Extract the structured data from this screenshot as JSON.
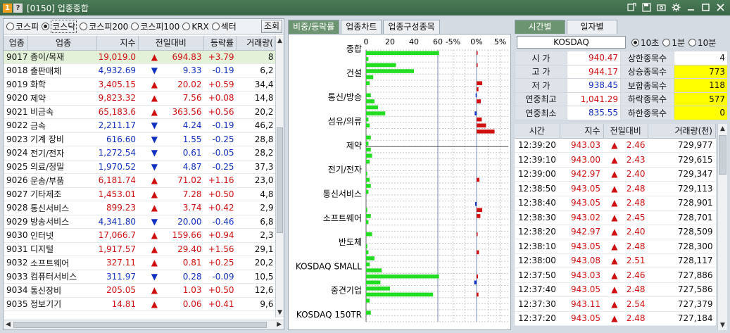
{
  "window": {
    "title": "[0150] 업종종합"
  },
  "market_radios": [
    {
      "label": "코스피",
      "selected": false
    },
    {
      "label": "코스닥",
      "selected": true
    },
    {
      "label": "코스피200",
      "selected": false
    },
    {
      "label": "코스피100",
      "selected": false
    },
    {
      "label": "KRX",
      "selected": false
    },
    {
      "label": "섹터",
      "selected": false
    }
  ],
  "query_button": "조회",
  "sector_table": {
    "headers": [
      "업종",
      "업종",
      "지수",
      "전일대비",
      "등락률",
      "거래량("
    ],
    "rows": [
      {
        "code": "9017",
        "name": "종이/목재",
        "index": "19,019.0",
        "dir": "up",
        "change": "694.83",
        "rate": "+3.79",
        "volume": "8"
      },
      {
        "code": "9018",
        "name": "출판매체",
        "index": "4,932.69",
        "dir": "down",
        "change": "9.33",
        "rate": "-0.19",
        "volume": "6,2"
      },
      {
        "code": "9019",
        "name": "화학",
        "index": "3,405.15",
        "dir": "up",
        "change": "20.02",
        "rate": "+0.59",
        "volume": "34,4"
      },
      {
        "code": "9020",
        "name": "제약",
        "index": "9,823.32",
        "dir": "up",
        "change": "7.56",
        "rate": "+0.08",
        "volume": "14,8"
      },
      {
        "code": "9021",
        "name": "비금속",
        "index": "65,183.6",
        "dir": "up",
        "change": "363.56",
        "rate": "+0.56",
        "volume": "20,2"
      },
      {
        "code": "9022",
        "name": "금속",
        "index": "2,211.17",
        "dir": "down",
        "change": "4.24",
        "rate": "-0.19",
        "volume": "46,2"
      },
      {
        "code": "9023",
        "name": "기계 장비",
        "index": "616.60",
        "dir": "down",
        "change": "1.55",
        "rate": "-0.25",
        "volume": "28,8"
      },
      {
        "code": "9024",
        "name": "전기/전자",
        "index": "1,272.54",
        "dir": "down",
        "change": "0.61",
        "rate": "-0.05",
        "volume": "28,2"
      },
      {
        "code": "9025",
        "name": "의료/정밀",
        "index": "1,970.52",
        "dir": "down",
        "change": "4.87",
        "rate": "-0.25",
        "volume": "37,3"
      },
      {
        "code": "9026",
        "name": "운송/부품",
        "index": "6,181.74",
        "dir": "up",
        "change": "71.02",
        "rate": "+1.16",
        "volume": "23,0"
      },
      {
        "code": "9027",
        "name": "기타제조",
        "index": "1,453.01",
        "dir": "up",
        "change": "7.28",
        "rate": "+0.50",
        "volume": "4,8"
      },
      {
        "code": "9028",
        "name": "통신서비스",
        "index": "899.23",
        "dir": "up",
        "change": "3.74",
        "rate": "+0.42",
        "volume": "2,9"
      },
      {
        "code": "9029",
        "name": "방송서비스",
        "index": "4,341.80",
        "dir": "down",
        "change": "20.00",
        "rate": "-0.46",
        "volume": "6,8"
      },
      {
        "code": "9030",
        "name": "인터넷",
        "index": "17,066.7",
        "dir": "up",
        "change": "159.66",
        "rate": "+0.94",
        "volume": "2,3"
      },
      {
        "code": "9031",
        "name": "디지털",
        "index": "1,917.57",
        "dir": "up",
        "change": "29.40",
        "rate": "+1.56",
        "volume": "29,1"
      },
      {
        "code": "9032",
        "name": "소프트웨어",
        "index": "327.11",
        "dir": "up",
        "change": "0.81",
        "rate": "+0.25",
        "volume": "20,2"
      },
      {
        "code": "9033",
        "name": "컴퓨터서비스",
        "index": "311.97",
        "dir": "down",
        "change": "0.28",
        "rate": "-0.09",
        "volume": "10,5"
      },
      {
        "code": "9034",
        "name": "통신장비",
        "index": "205.05",
        "dir": "up",
        "change": "1.03",
        "rate": "+0.50",
        "volume": "12,6"
      },
      {
        "code": "9035",
        "name": "정보기기",
        "index": "14.81",
        "dir": "up",
        "change": "0.06",
        "rate": "+0.41",
        "volume": "9,6"
      }
    ]
  },
  "mid_tabs": [
    "비중/등락률",
    "업종차트",
    "업종구성종목"
  ],
  "chart_data": {
    "type": "bar",
    "categories": [
      "종합",
      "건설",
      "통신/방송",
      "섬유/의류",
      "제약",
      "전기/전자",
      "통신서비스",
      "소프트웨어",
      "반도체",
      "KOSDAQ SMALL",
      "중견기업",
      "KOSDAQ 150TR"
    ],
    "weight_axis": [
      0,
      20,
      40,
      60
    ],
    "rate_axis": [
      "-5%",
      "0%",
      "5%"
    ],
    "weight_values": [
      61,
      2,
      25,
      40,
      6,
      3,
      0,
      4,
      7,
      10,
      16,
      2,
      3,
      0,
      4,
      2,
      4,
      5,
      3,
      0,
      1,
      3,
      4,
      2,
      0,
      0,
      1,
      4,
      2,
      0,
      5,
      0,
      1,
      2,
      7,
      3,
      13,
      61,
      12,
      20,
      56,
      3,
      0,
      4,
      0
    ],
    "rate_values": [
      0.1,
      0,
      0.2,
      0,
      0,
      1.2,
      0.4,
      -0.2,
      0.9,
      0,
      -0.4,
      1.1,
      2.0,
      3.8,
      0,
      0,
      0,
      0,
      0,
      0,
      0,
      0.6,
      0,
      0,
      0,
      -0.3,
      1.2,
      0.8,
      0,
      0,
      0.2,
      0,
      0,
      0.5,
      0,
      0,
      0,
      0.3,
      -0.5,
      0,
      0.4,
      0,
      0,
      0,
      0
    ]
  },
  "right_tabs": [
    "시간별",
    "일자별"
  ],
  "market_name": "KOSDAQ",
  "interval_radios": [
    {
      "label": "10초",
      "selected": true
    },
    {
      "label": "1분",
      "selected": false
    },
    {
      "label": "10분",
      "selected": false
    }
  ],
  "stats": [
    {
      "label": "시    가",
      "value": "940.47",
      "dir": "up",
      "label2": "상한종목수",
      "value2": "4",
      "hl": false
    },
    {
      "label": "고    가",
      "value": "944.17",
      "dir": "up",
      "label2": "상승종목수",
      "value2": "773",
      "hl": true
    },
    {
      "label": "저    가",
      "value": "938.45",
      "dir": "down",
      "label2": "보합종목수",
      "value2": "118",
      "hl": true
    },
    {
      "label": "연중최고",
      "value": "1,041.29",
      "dir": "up",
      "label2": "하락종목수",
      "value2": "577",
      "hl": true
    },
    {
      "label": "연중최소",
      "value": "835.55",
      "dir": "down",
      "label2": "하한종목수",
      "value2": "0",
      "hl": true
    }
  ],
  "tick_table": {
    "headers": [
      "시간",
      "지수",
      "전일대비",
      "거래량(천)"
    ],
    "rows": [
      {
        "time": "12:39:20",
        "index": "943.03",
        "change": "2.46",
        "volume": "729,977"
      },
      {
        "time": "12:39:10",
        "index": "943.00",
        "change": "2.43",
        "volume": "729,615"
      },
      {
        "time": "12:39:00",
        "index": "942.97",
        "change": "2.40",
        "volume": "729,347"
      },
      {
        "time": "12:38:50",
        "index": "943.05",
        "change": "2.48",
        "volume": "729,113"
      },
      {
        "time": "12:38:40",
        "index": "943.05",
        "change": "2.48",
        "volume": "728,901"
      },
      {
        "time": "12:38:30",
        "index": "943.02",
        "change": "2.45",
        "volume": "728,701"
      },
      {
        "time": "12:38:20",
        "index": "942.97",
        "change": "2.40",
        "volume": "728,509"
      },
      {
        "time": "12:38:10",
        "index": "943.05",
        "change": "2.48",
        "volume": "728,300"
      },
      {
        "time": "12:38:00",
        "index": "943.08",
        "change": "2.51",
        "volume": "728,117"
      },
      {
        "time": "12:37:50",
        "index": "943.03",
        "change": "2.46",
        "volume": "727,886"
      },
      {
        "time": "12:37:40",
        "index": "943.05",
        "change": "2.48",
        "volume": "727,586"
      },
      {
        "time": "12:37:30",
        "index": "943.11",
        "change": "2.54",
        "volume": "727,379"
      },
      {
        "time": "12:37:20",
        "index": "943.05",
        "change": "2.48",
        "volume": "727,184"
      }
    ]
  },
  "colors": {
    "up": "#d01010",
    "down": "#1030c0",
    "bar": "#22dd22",
    "accent": "#6d9470"
  },
  "icons": [
    "link-icon",
    "save-icon",
    "camera-icon",
    "gear-icon",
    "minimize-icon",
    "maximize-icon",
    "close-icon"
  ]
}
